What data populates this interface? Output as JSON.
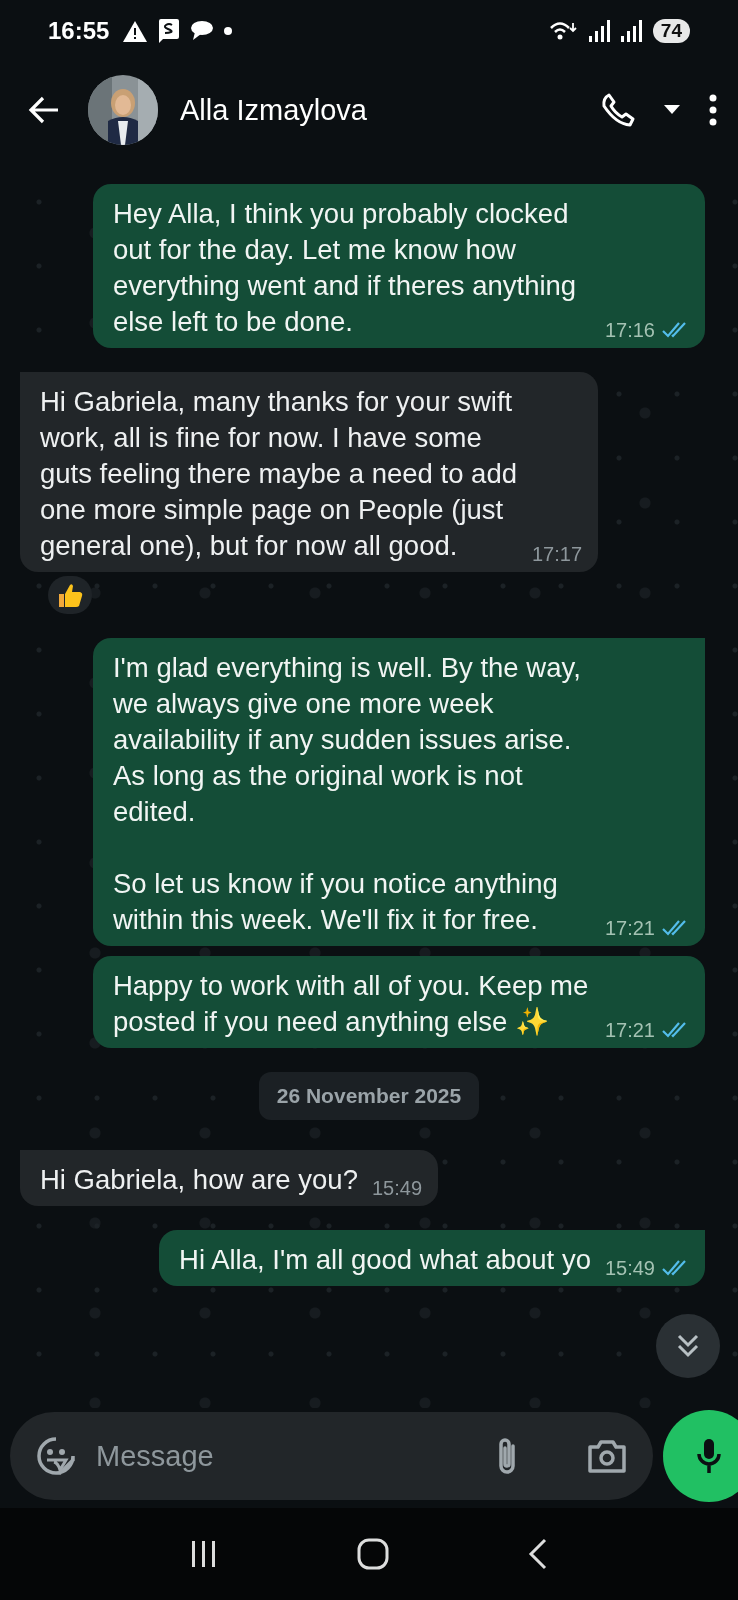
{
  "status_bar": {
    "time": "16:55",
    "battery": "74"
  },
  "header": {
    "contact_name": "Alla Izmaylova"
  },
  "messages": [
    {
      "kind": "outgoing",
      "tail": false,
      "text": "Hey Alla, I think you probably clocked out for the day. Let me know how everything went and if theres anything else left to be done.",
      "time": "17:16",
      "read": true
    },
    {
      "kind": "incoming",
      "tail": true,
      "text": "Hi Gabriela, many thanks for your swift work, all is fine for now. I have some guts feeling there maybe a need to add one more simple page on People (just general one), but for now all good.",
      "time": "17:17",
      "reacted": true
    },
    {
      "kind": "outgoing",
      "tail": true,
      "text": "I'm glad everything is well. By the way, we always give one more week availability if any sudden issues arise. As long as the original work is not edited.\n\nSo let us know if you notice anything within this week. We'll fix it for free.",
      "time": "17:21",
      "read": true
    },
    {
      "kind": "outgoing",
      "tail": false,
      "text": "Happy to work with all of you. Keep me posted if you need anything else ✨",
      "time": "17:21",
      "read": true
    },
    {
      "kind": "date",
      "text": "26 November 2025"
    },
    {
      "kind": "incoming",
      "tail": true,
      "text": "Hi Gabriela, how are you?",
      "time": "15:49"
    },
    {
      "kind": "outgoing",
      "tail": true,
      "text": "Hi Alla, I'm all good what about yo",
      "time": "15:49",
      "read": true
    }
  ],
  "composer": {
    "placeholder": "Message"
  }
}
